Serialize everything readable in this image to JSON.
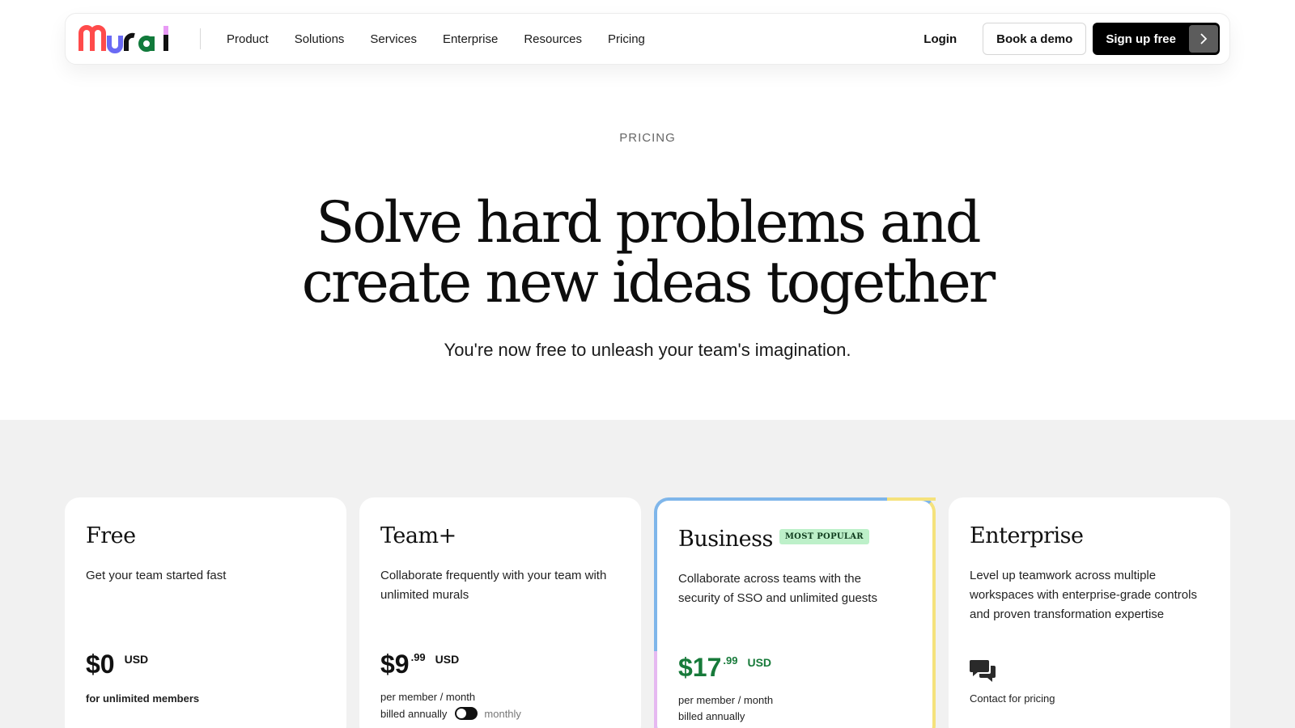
{
  "nav": {
    "logo_text": "Mural",
    "links": [
      "Product",
      "Solutions",
      "Services",
      "Enterprise",
      "Resources",
      "Pricing"
    ],
    "login": "Login",
    "book_demo": "Book a demo",
    "signup": "Sign up free",
    "signup_icon": "chevron-right-icon"
  },
  "hero": {
    "eyebrow": "PRICING",
    "title_line1": "Solve hard problems and",
    "title_line2": "create new ideas together",
    "subtitle": "You're now free to unleash your team's imagination."
  },
  "plans": [
    {
      "name": "Free",
      "description": "Get your team started fast",
      "price": "$0",
      "cents": "",
      "currency": "USD",
      "note": "for unlimited members"
    },
    {
      "name": "Team+",
      "description": "Collaborate frequently with your team with unlimited murals",
      "price": "$9",
      "cents": ".99",
      "currency": "USD",
      "note1": "per member / month",
      "note2": "billed annually",
      "toggle_alt": "monthly"
    },
    {
      "name": "Business",
      "badge": "MOST POPULAR",
      "description": "Collaborate across teams with the security of SSO and unlimited guests",
      "price": "$17",
      "cents": ".99",
      "currency": "USD",
      "note1": "per member / month",
      "note2": "billed annually"
    },
    {
      "name": "Enterprise",
      "description": "Level up teamwork across multiple workspaces with enterprise-grade controls and proven transformation expertise",
      "icon": "chat-bubbles-icon",
      "note": "Contact for pricing"
    }
  ],
  "colors": {
    "accent_green": "#177a3a",
    "badge_bg": "#bdf0c9",
    "business_border_blue": "#7fb6ea",
    "business_border_yellow": "#f5e27c",
    "logo_red": "#ff4b4b",
    "logo_blue": "#6a6af4",
    "logo_green": "#117a3b"
  }
}
